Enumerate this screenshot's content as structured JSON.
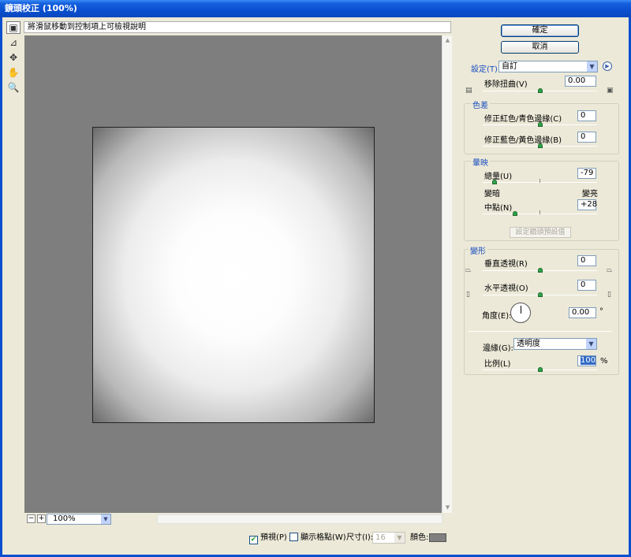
{
  "window": {
    "title": "鏡頭校正 (100%)"
  },
  "hint": "將滑鼠移動到控制項上可檢視說明",
  "tools": [
    {
      "name": "remove-distortion-tool-icon",
      "glyph": "▣"
    },
    {
      "name": "straighten-tool-icon",
      "glyph": "⊿"
    },
    {
      "name": "move-grid-tool-icon",
      "glyph": "✥"
    },
    {
      "name": "hand-tool-icon",
      "glyph": "✋"
    },
    {
      "name": "zoom-tool-icon",
      "glyph": "🔍"
    }
  ],
  "zoom": {
    "value": "100%",
    "minus": "−",
    "plus": "+"
  },
  "footer": {
    "preview_label": "預視(P)",
    "preview_checked": "✔",
    "grid_label": "顯示格點(W)",
    "size_label": "尺寸(I):",
    "size_value": "16",
    "color_label": "顏色:",
    "grid_color": "#808080"
  },
  "buttons": {
    "ok": "確定",
    "cancel": "取消"
  },
  "settings": {
    "label": "設定(T):",
    "value": "自訂"
  },
  "remove_distortion": {
    "label": "移除扭曲(V)",
    "value": "0.00",
    "slider": 0.5
  },
  "chromatic": {
    "title": "色差",
    "red_cyan": {
      "label": "修正紅色/青色邊緣(C)",
      "value": "0",
      "slider": 0.5
    },
    "blue_yellow": {
      "label": "修正藍色/黃色邊緣(B)",
      "value": "0",
      "slider": 0.5
    }
  },
  "vignette": {
    "title": "暈映",
    "amount": {
      "label": "總量(U)",
      "value": "-79",
      "slider": 0.105,
      "left_label": "變暗",
      "right_label": "變亮"
    },
    "midpoint": {
      "label": "中點(N)",
      "value": "+28",
      "slider": 0.28
    }
  },
  "set_lens_default": "設定鏡頭預設值",
  "transform": {
    "title": "變形",
    "vertical": {
      "label": "垂直透視(R)",
      "value": "0",
      "slider": 0.5
    },
    "horizontal": {
      "label": "水平透視(O)",
      "value": "0",
      "slider": 0.5
    },
    "angle": {
      "label": "角度(E):",
      "value": "0.00",
      "unit": "°"
    },
    "edge": {
      "label": "邊緣(G):",
      "value": "透明度"
    },
    "scale": {
      "label": "比例(L)",
      "value": "100",
      "unit": "%",
      "slider": 0.5
    }
  }
}
